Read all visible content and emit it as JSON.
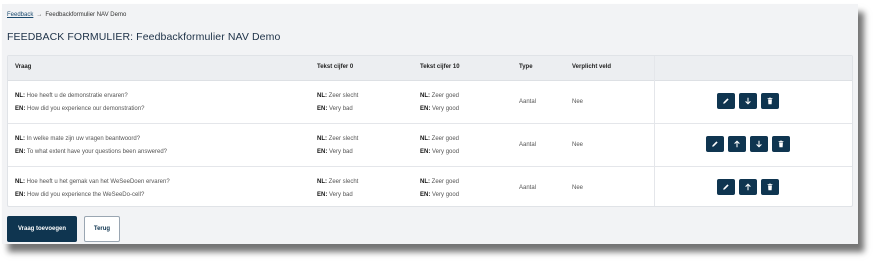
{
  "breadcrumb": {
    "root": "Feedback",
    "separator": "→",
    "current": "Feedbackformulier NAV Demo"
  },
  "page": {
    "title": "FEEDBACK FORMULIER: Feedbackformulier NAV Demo"
  },
  "table": {
    "headers": {
      "question": "Vraag",
      "text0": "Tekst cijfer 0",
      "text10": "Tekst cijfer 10",
      "type": "Type",
      "required": "Verplicht veld"
    },
    "lang_labels": {
      "nl": "NL:",
      "en": "EN:"
    },
    "rows": [
      {
        "q_nl": "Hoe heeft u de demonstratie ervaren?",
        "q_en": "How did you experience our demonstration?",
        "t0_nl": "Zeer slecht",
        "t0_en": "Very bad",
        "t10_nl": "Zeer goed",
        "t10_en": "Very good",
        "type": "Aantal",
        "required": "Nee"
      },
      {
        "q_nl": "In welke mate zijn uw vragen beantwoord?",
        "q_en": "To what extent have your questions been answered?",
        "t0_nl": "Zeer slecht",
        "t0_en": "Very bad",
        "t10_nl": "Zeer goed",
        "t10_en": "Very good",
        "type": "Aantal",
        "required": "Nee"
      },
      {
        "q_nl": "Hoe heeft u het gemak van het WeSeeDoen ervaren?",
        "q_en": "How did you experience the WeSeeDo-cell?",
        "t0_nl": "Zeer slecht",
        "t0_en": "Very bad",
        "t10_nl": "Zeer goed",
        "t10_en": "Very good",
        "type": "Aantal",
        "required": "Nee"
      }
    ]
  },
  "actions": {
    "add_question": "Vraag toevoegen",
    "back": "Terug"
  },
  "icons": {
    "edit": "pencil-icon",
    "up": "arrow-up-icon",
    "down": "arrow-down-icon",
    "delete": "trash-icon"
  },
  "colors": {
    "primary": "#0f3550",
    "background": "#f2f3f5",
    "header": "#eceef1"
  }
}
